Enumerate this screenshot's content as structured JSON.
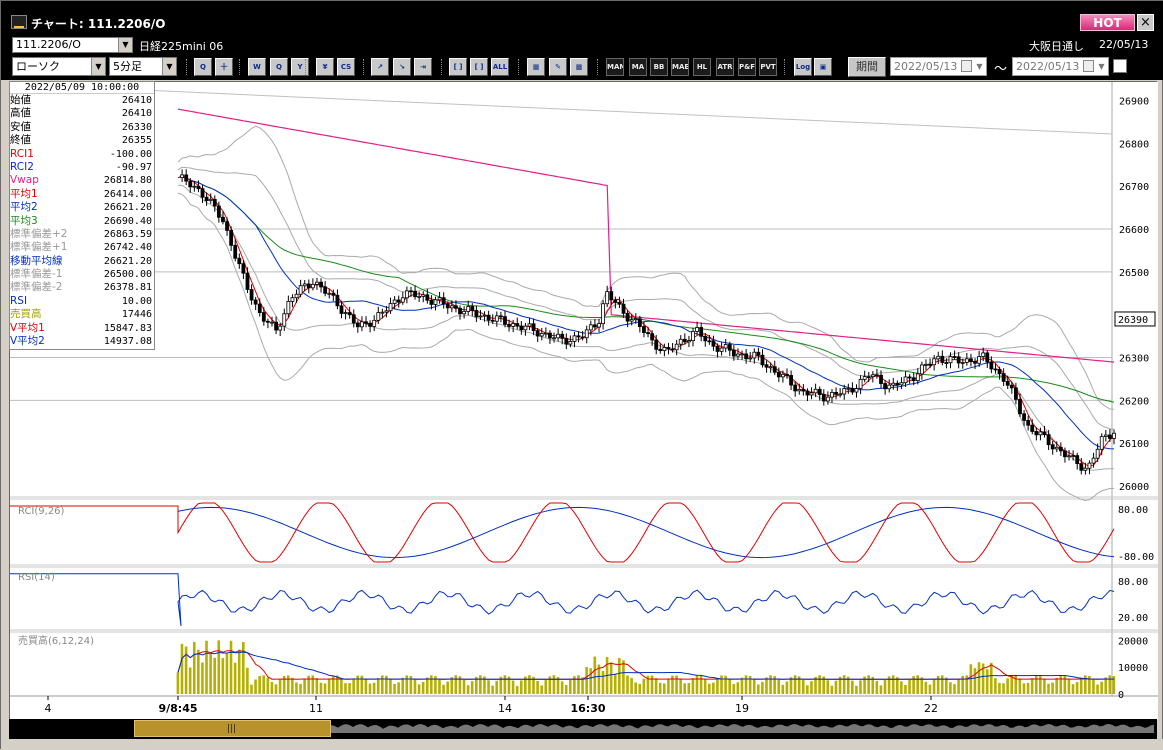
{
  "window": {
    "title": "チャート: 111.2206/O",
    "hot_label": "HOT",
    "close_glyph": "×"
  },
  "header": {
    "symbol_code": "111.2206/O",
    "symbol_name": "日経225mini 06",
    "session": "大阪日通し",
    "date": "22/05/13"
  },
  "toolbar": {
    "chart_type": "ローソク",
    "interval": "5分足",
    "period_label": "期間",
    "date_from": "2022/05/13",
    "date_to": "2022/05/13",
    "tilde": "〜",
    "buttons": [
      "Q",
      "十",
      "W",
      "Q",
      "Y",
      "¥",
      "CS",
      "↗",
      "↘",
      "⇥",
      "[ ]",
      "[ ]",
      "ALL",
      "▦",
      "✎",
      "▩",
      "MAM",
      "MA",
      "BB",
      "MAE",
      "HL",
      "ATR",
      "P&F",
      "PVT",
      "Log",
      "▣"
    ]
  },
  "info_panel": {
    "datetime": "2022/05/09  10:00:00",
    "rows": [
      {
        "label": "始値",
        "value": "26410",
        "color": "#000000"
      },
      {
        "label": "高値",
        "value": "26410",
        "color": "#000000"
      },
      {
        "label": "安値",
        "value": "26330",
        "color": "#000000"
      },
      {
        "label": "終値",
        "value": "26355",
        "color": "#000000"
      },
      {
        "label": "RCI1",
        "value": "-100.00",
        "color": "#e00000"
      },
      {
        "label": "RCI2",
        "value": "-90.97",
        "color": "#0030c0"
      },
      {
        "label": "Vwap",
        "value": "26814.80",
        "color": "#e0208c"
      },
      {
        "label": "平均1",
        "value": "26414.00",
        "color": "#e00000"
      },
      {
        "label": "平均2",
        "value": "26621.20",
        "color": "#0030c0"
      },
      {
        "label": "平均3",
        "value": "26690.40",
        "color": "#1a8a1a"
      },
      {
        "label": "標準偏差+2",
        "value": "26863.59",
        "color": "#999999"
      },
      {
        "label": "標準偏差+1",
        "value": "26742.40",
        "color": "#999999"
      },
      {
        "label": "移動平均線",
        "value": "26621.20",
        "color": "#0030c0"
      },
      {
        "label": "標準偏差-1",
        "value": "26500.00",
        "color": "#999999"
      },
      {
        "label": "標準偏差-2",
        "value": "26378.81",
        "color": "#999999"
      },
      {
        "label": "RSI",
        "value": "10.00",
        "color": "#0030c0"
      },
      {
        "label": "売買高",
        "value": "17446",
        "color": "#a0a000"
      },
      {
        "label": "V平均1",
        "value": "15847.83",
        "color": "#e00000"
      },
      {
        "label": "V平均2",
        "value": "14937.08",
        "color": "#0030c0"
      }
    ]
  },
  "price_axis": {
    "ticks": [
      "26900",
      "26800",
      "26700",
      "26600",
      "26500",
      "26400",
      "26300",
      "26200",
      "26100",
      "26000"
    ],
    "current": "26390"
  },
  "rci_panel": {
    "label": "RCI(9,26)",
    "ticks": [
      "80.00",
      "-80.00"
    ]
  },
  "rsi_panel": {
    "label": "RSI(14)",
    "ticks": [
      "80.00",
      "20.00"
    ]
  },
  "vol_panel": {
    "label": "売買高(6,12,24)",
    "ticks": [
      "20000",
      "10000",
      "0"
    ]
  },
  "time_axis": {
    "labels": [
      "4",
      "9/8:45",
      "11",
      "14",
      "16:30",
      "19",
      "22"
    ]
  },
  "colors": {
    "vwap": "#e0208c",
    "ma1": "#e00000",
    "ma2": "#0030c0",
    "ma3": "#1a8a1a",
    "band": "#aaaaaa",
    "volume": "#b5b000"
  }
}
